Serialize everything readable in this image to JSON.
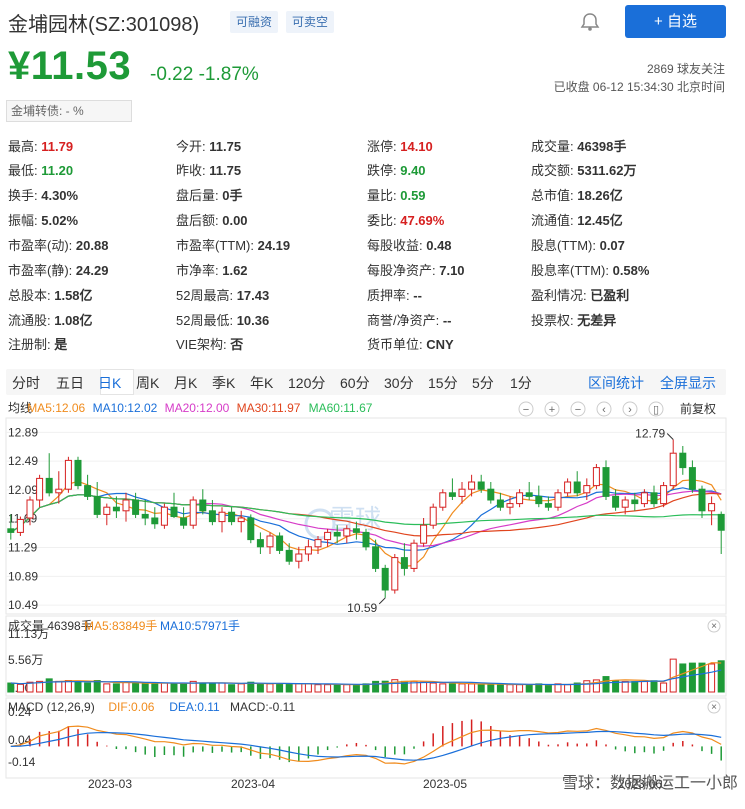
{
  "header": {
    "name": "金埔园林(SZ:301098)",
    "tag_margin": "可融资",
    "tag_short": "可卖空",
    "follow_label": "+ 自选"
  },
  "quote": {
    "price": "¥11.53",
    "change": "-0.22 -1.87%",
    "followers": "2869 球友关注",
    "status": "已收盘 06-12 15:34:30 北京时间",
    "convertible": "金埔转债: -     %"
  },
  "stats": [
    [
      {
        "k": "最高:",
        "v": "11.79",
        "c": "r"
      },
      {
        "k": "今开:",
        "v": "11.75",
        "c": ""
      },
      {
        "k": "涨停:",
        "v": "14.10",
        "c": "r"
      },
      {
        "k": "成交量:",
        "v": "46398手",
        "c": ""
      }
    ],
    [
      {
        "k": "最低:",
        "v": "11.20",
        "c": "g"
      },
      {
        "k": "昨收:",
        "v": "11.75",
        "c": ""
      },
      {
        "k": "跌停:",
        "v": "9.40",
        "c": "g"
      },
      {
        "k": "成交额:",
        "v": "5311.62万",
        "c": ""
      }
    ],
    [
      {
        "k": "换手:",
        "v": "4.30%",
        "c": ""
      },
      {
        "k": "盘后量:",
        "v": "0手",
        "c": ""
      },
      {
        "k": "量比:",
        "v": "0.59",
        "c": "g"
      },
      {
        "k": "总市值:",
        "v": "18.26亿",
        "c": ""
      }
    ],
    [
      {
        "k": "振幅:",
        "v": "5.02%",
        "c": ""
      },
      {
        "k": "盘后额:",
        "v": "0.00",
        "c": ""
      },
      {
        "k": "委比:",
        "v": "47.69%",
        "c": "r"
      },
      {
        "k": "流通值:",
        "v": "12.45亿",
        "c": ""
      }
    ],
    [
      {
        "k": "市盈率(动):",
        "v": "20.88",
        "c": ""
      },
      {
        "k": "市盈率(TTM):",
        "v": "24.19",
        "c": ""
      },
      {
        "k": "每股收益:",
        "v": "0.48",
        "c": ""
      },
      {
        "k": "股息(TTM):",
        "v": "0.07",
        "c": ""
      }
    ],
    [
      {
        "k": "市盈率(静):",
        "v": "24.29",
        "c": ""
      },
      {
        "k": "市净率:",
        "v": "1.62",
        "c": ""
      },
      {
        "k": "每股净资产:",
        "v": "7.10",
        "c": ""
      },
      {
        "k": "股息率(TTM):",
        "v": "0.58%",
        "c": ""
      }
    ],
    [
      {
        "k": "总股本:",
        "v": "1.58亿",
        "c": ""
      },
      {
        "k": "52周最高:",
        "v": "17.43",
        "c": ""
      },
      {
        "k": "质押率:",
        "v": "--",
        "c": ""
      },
      {
        "k": "盈利情况:",
        "v": "已盈利",
        "c": ""
      }
    ],
    [
      {
        "k": "流通股:",
        "v": "1.08亿",
        "c": ""
      },
      {
        "k": "52周最低:",
        "v": "10.36",
        "c": ""
      },
      {
        "k": "商誉/净资产:",
        "v": "--",
        "c": ""
      },
      {
        "k": "投票权:",
        "v": "无差异",
        "c": ""
      }
    ],
    [
      {
        "k": "注册制:",
        "v": "是",
        "c": ""
      },
      {
        "k": "VIE架构:",
        "v": "否",
        "c": ""
      },
      {
        "k": "货币单位:",
        "v": "CNY",
        "c": ""
      },
      null
    ]
  ],
  "tabs": [
    "分时",
    "五日",
    "日K",
    "周K",
    "月K",
    "季K",
    "年K",
    "120分",
    "60分",
    "30分",
    "15分",
    "5分",
    "1分"
  ],
  "tabs_right": [
    "区间统计",
    "全屏显示"
  ],
  "adjust_label": "前复权",
  "ma_legend": [
    {
      "t": "均线",
      "c": "#333"
    },
    {
      "t": "MA5:12.06",
      "c": "#f08c1e"
    },
    {
      "t": "MA10:12.02",
      "c": "#1a6fd9"
    },
    {
      "t": "MA20:12.00",
      "c": "#d63cc8"
    },
    {
      "t": "MA30:11.97",
      "c": "#e0451e"
    },
    {
      "t": "MA60:11.67",
      "c": "#2bbd5a"
    }
  ],
  "vol_legend": [
    {
      "t": "成交量 46398手",
      "c": "#333"
    },
    {
      "t": "MA5:83849手",
      "c": "#f08c1e"
    },
    {
      "t": "MA10:57971手",
      "c": "#1a6fd9"
    }
  ],
  "macd_legend": [
    {
      "t": "MACD (12,26,9)",
      "c": "#333"
    },
    {
      "t": "DIF:0.06",
      "c": "#f08c1e"
    },
    {
      "t": "DEA:0.11",
      "c": "#1a6fd9"
    },
    {
      "t": "MACD:-0.11",
      "c": "#333"
    }
  ],
  "price_axis": [
    "12.89",
    "12.49",
    "12.09",
    "11.69",
    "11.29",
    "10.89",
    "10.49"
  ],
  "vol_axis": [
    "11.13万",
    "5.56万",
    "0.00"
  ],
  "macd_axis": [
    "0.24",
    "0.04",
    "-0.14"
  ],
  "date_axis": [
    "2023-03",
    "2023-04",
    "2023-05",
    "2023-06"
  ],
  "annotations": {
    "high": "12.79",
    "low": "10.59"
  },
  "watermark": "雪球",
  "footer_wm": "雪球：数据搬运工一小郎",
  "colors": {
    "up": "#d62020",
    "down": "#1e9a37",
    "accent": "#1a6fd9"
  },
  "chart_data": {
    "type": "candlestick",
    "ohlc": [
      [
        11.55,
        11.75,
        11.4,
        11.5
      ],
      [
        11.5,
        11.72,
        11.45,
        11.68
      ],
      [
        11.7,
        12.0,
        11.6,
        11.95
      ],
      [
        11.95,
        12.3,
        11.85,
        12.25
      ],
      [
        12.25,
        12.6,
        12.0,
        12.05
      ],
      [
        12.05,
        12.35,
        11.9,
        12.1
      ],
      [
        12.1,
        12.55,
        12.05,
        12.5
      ],
      [
        12.5,
        12.55,
        12.1,
        12.15
      ],
      [
        12.15,
        12.3,
        11.95,
        12.0
      ],
      [
        12.0,
        12.2,
        11.7,
        11.75
      ],
      [
        11.75,
        11.9,
        11.6,
        11.85
      ],
      [
        11.85,
        12.0,
        11.7,
        11.8
      ],
      [
        11.8,
        12.05,
        11.65,
        11.95
      ],
      [
        11.95,
        12.05,
        11.7,
        11.75
      ],
      [
        11.75,
        11.95,
        11.6,
        11.7
      ],
      [
        11.7,
        11.85,
        11.55,
        11.62
      ],
      [
        11.6,
        11.9,
        11.55,
        11.85
      ],
      [
        11.85,
        12.05,
        11.7,
        11.72
      ],
      [
        11.7,
        11.85,
        11.55,
        11.6
      ],
      [
        11.6,
        12.0,
        11.55,
        11.95
      ],
      [
        11.95,
        12.1,
        11.75,
        11.8
      ],
      [
        11.8,
        11.95,
        11.6,
        11.65
      ],
      [
        11.65,
        11.85,
        11.5,
        11.78
      ],
      [
        11.78,
        11.85,
        11.6,
        11.65
      ],
      [
        11.65,
        11.8,
        11.5,
        11.7
      ],
      [
        11.7,
        11.75,
        11.35,
        11.4
      ],
      [
        11.4,
        11.5,
        11.2,
        11.3
      ],
      [
        11.3,
        11.5,
        11.2,
        11.45
      ],
      [
        11.45,
        11.5,
        11.2,
        11.25
      ],
      [
        11.25,
        11.35,
        11.05,
        11.1
      ],
      [
        11.1,
        11.3,
        11.0,
        11.2
      ],
      [
        11.2,
        11.4,
        11.1,
        11.3
      ],
      [
        11.3,
        11.45,
        11.2,
        11.4
      ],
      [
        11.4,
        11.55,
        11.3,
        11.5
      ],
      [
        11.5,
        11.6,
        11.35,
        11.45
      ],
      [
        11.45,
        11.6,
        11.35,
        11.55
      ],
      [
        11.55,
        11.65,
        11.4,
        11.5
      ],
      [
        11.5,
        11.55,
        11.25,
        11.3
      ],
      [
        11.3,
        11.4,
        10.95,
        11.0
      ],
      [
        11.0,
        11.05,
        10.59,
        10.7
      ],
      [
        10.7,
        11.2,
        10.65,
        11.15
      ],
      [
        11.15,
        11.35,
        10.9,
        11.0
      ],
      [
        11.0,
        11.4,
        10.95,
        11.35
      ],
      [
        11.35,
        11.7,
        11.3,
        11.6
      ],
      [
        11.6,
        11.9,
        11.55,
        11.85
      ],
      [
        11.85,
        12.1,
        11.8,
        12.05
      ],
      [
        12.05,
        12.25,
        11.95,
        12.0
      ],
      [
        12.0,
        12.2,
        11.9,
        12.1
      ],
      [
        12.1,
        12.3,
        12.0,
        12.2
      ],
      [
        12.2,
        12.3,
        12.05,
        12.1
      ],
      [
        12.1,
        12.2,
        11.9,
        11.95
      ],
      [
        11.95,
        12.05,
        11.8,
        11.85
      ],
      [
        11.85,
        12.0,
        11.75,
        11.9
      ],
      [
        11.9,
        12.1,
        11.85,
        12.05
      ],
      [
        12.05,
        12.2,
        11.95,
        12.0
      ],
      [
        12.0,
        12.15,
        11.85,
        11.9
      ],
      [
        11.9,
        12.0,
        11.8,
        11.85
      ],
      [
        11.85,
        12.1,
        11.8,
        12.05
      ],
      [
        12.05,
        12.25,
        12.0,
        12.2
      ],
      [
        12.2,
        12.35,
        12.0,
        12.05
      ],
      [
        12.05,
        12.25,
        11.95,
        12.15
      ],
      [
        12.15,
        12.45,
        12.1,
        12.4
      ],
      [
        12.4,
        12.5,
        11.95,
        12.0
      ],
      [
        12.0,
        12.1,
        11.8,
        11.85
      ],
      [
        11.85,
        12.0,
        11.75,
        11.95
      ],
      [
        11.95,
        12.05,
        11.8,
        11.9
      ],
      [
        11.9,
        12.1,
        11.85,
        12.05
      ],
      [
        12.05,
        12.15,
        11.85,
        11.9
      ],
      [
        11.9,
        12.2,
        11.85,
        12.15
      ],
      [
        12.15,
        12.79,
        12.1,
        12.6
      ],
      [
        12.6,
        12.7,
        12.3,
        12.4
      ],
      [
        12.4,
        12.5,
        12.05,
        12.1
      ],
      [
        12.1,
        12.15,
        11.7,
        11.8
      ],
      [
        11.8,
        12.0,
        11.6,
        11.9
      ],
      [
        11.75,
        11.79,
        11.2,
        11.53
      ]
    ]
  }
}
